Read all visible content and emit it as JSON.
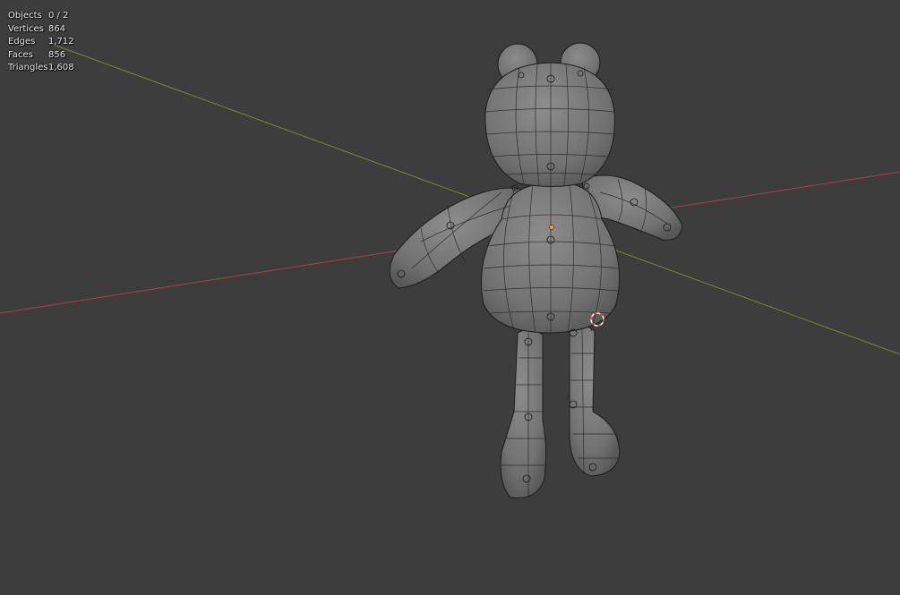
{
  "stats": [
    {
      "label": "Objects",
      "value": "0 / 2"
    },
    {
      "label": "Vertices",
      "value": "864"
    },
    {
      "label": "Edges",
      "value": "1,712"
    },
    {
      "label": "Faces",
      "value": "856"
    },
    {
      "label": "Triangles",
      "value": "1,608"
    }
  ],
  "colors": {
    "background": "#3d3d3d",
    "x_axis": "#a9434a",
    "y_axis": "#6f8f32",
    "mesh_fill": "#7a7a7a",
    "wire": "#1d1d1d",
    "origin": "#ff9a1f",
    "cursor_red": "#e04040",
    "cursor_white": "#ffffff"
  }
}
